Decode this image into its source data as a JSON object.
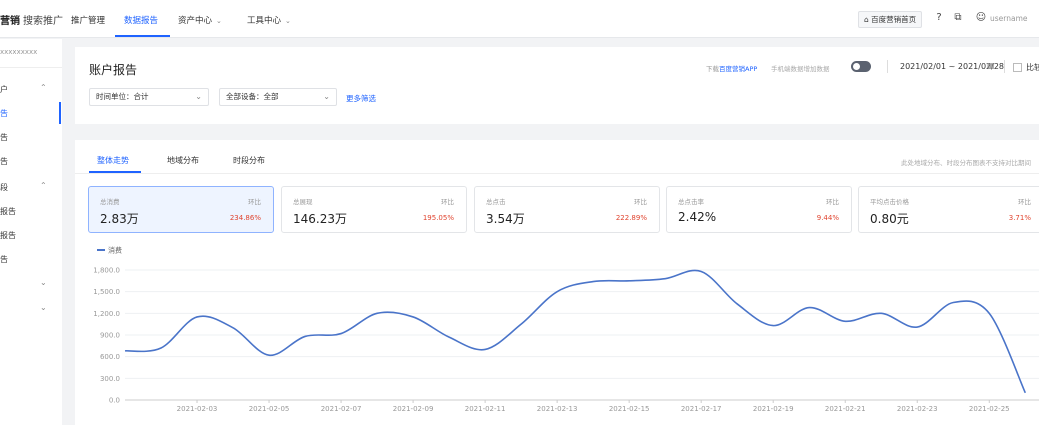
{
  "topbar": {
    "brand_main": "营销",
    "brand_sub": "搜索推广",
    "nav": [
      {
        "label": "推广管理",
        "active": false,
        "dropdown": false
      },
      {
        "label": "数据报告",
        "active": true,
        "dropdown": false
      },
      {
        "label": "资产中心",
        "active": false,
        "dropdown": true
      },
      {
        "label": "工具中心",
        "active": false,
        "dropdown": true
      }
    ],
    "home_label": "百度营销首页",
    "user_name": "username"
  },
  "sidebar": {
    "account": "xxxxxxxxx",
    "items": [
      {
        "label": "户",
        "active": false
      },
      {
        "label": "告",
        "active": true
      },
      {
        "label": "告",
        "active": false
      },
      {
        "label": "告",
        "active": false
      },
      {
        "label": "段",
        "active": false
      },
      {
        "label": "报告",
        "active": false
      },
      {
        "label": "报告",
        "active": false
      },
      {
        "label": "告",
        "active": false
      }
    ]
  },
  "report": {
    "title": "账户报告",
    "time_unit": "时间单位：合计",
    "device": "全部设备：全部",
    "more_filter": "更多筛选",
    "download_prefix": "下载",
    "download_link": "百度营销APP",
    "toggle_label": "手机端数据增加数据",
    "date_range": "2021/02/01 ~ 2021/02/28",
    "compare_label": "比较"
  },
  "tabs": [
    {
      "label": "整体走势",
      "active": true
    },
    {
      "label": "地域分布",
      "active": false
    },
    {
      "label": "时段分布",
      "active": false
    }
  ],
  "tab_note": "此处地域分布、时段分布图表不支持对比期间",
  "metrics": [
    {
      "label": "总消费",
      "value": "2.83万",
      "cmp_label": "环比",
      "cmp": "234.86%",
      "active": true
    },
    {
      "label": "总展现",
      "value": "146.23万",
      "cmp_label": "环比",
      "cmp": "195.05%",
      "active": false
    },
    {
      "label": "总点击",
      "value": "3.54万",
      "cmp_label": "环比",
      "cmp": "222.89%",
      "active": false
    },
    {
      "label": "总点击率",
      "value": "2.42%",
      "cmp_label": "环比",
      "cmp": "9.44%",
      "active": false
    },
    {
      "label": "平均点击价格",
      "value": "0.80元",
      "cmp_label": "环比",
      "cmp": "3.71%",
      "active": false
    }
  ],
  "colors": {
    "accent": "#1f63ff",
    "line": "#4a74c9",
    "up": "#e0442f"
  },
  "chart_data": {
    "type": "line",
    "legend": "消费",
    "legend_position": "top-left",
    "grid": true,
    "ylim": [
      0,
      1800
    ],
    "yticks": [
      "0.0",
      "300.0",
      "600.0",
      "900.0",
      "1,200.0",
      "1,500.0",
      "1,800.0"
    ],
    "ytick_values": [
      0,
      300,
      600,
      900,
      1200,
      1500,
      1800
    ],
    "x": [
      "2021-02-01",
      "2021-02-02",
      "2021-02-03",
      "2021-02-04",
      "2021-02-05",
      "2021-02-06",
      "2021-02-07",
      "2021-02-08",
      "2021-02-09",
      "2021-02-10",
      "2021-02-11",
      "2021-02-12",
      "2021-02-13",
      "2021-02-14",
      "2021-02-15",
      "2021-02-16",
      "2021-02-17",
      "2021-02-18",
      "2021-02-19",
      "2021-02-20",
      "2021-02-21",
      "2021-02-22",
      "2021-02-23",
      "2021-02-24",
      "2021-02-25",
      "2021-02-26"
    ],
    "xtick_labels": [
      "2021-02-03",
      "2021-02-05",
      "2021-02-07",
      "2021-02-09",
      "2021-02-11",
      "2021-02-13",
      "2021-02-15",
      "2021-02-17",
      "2021-02-19",
      "2021-02-21",
      "2021-02-23",
      "2021-02-25"
    ],
    "series": [
      {
        "name": "消费",
        "values": [
          680,
          720,
          1150,
          1000,
          620,
          880,
          920,
          1200,
          1150,
          870,
          700,
          1050,
          1500,
          1640,
          1650,
          1680,
          1780,
          1330,
          1030,
          1280,
          1090,
          1200,
          1010,
          1350,
          1200,
          100
        ]
      }
    ]
  }
}
